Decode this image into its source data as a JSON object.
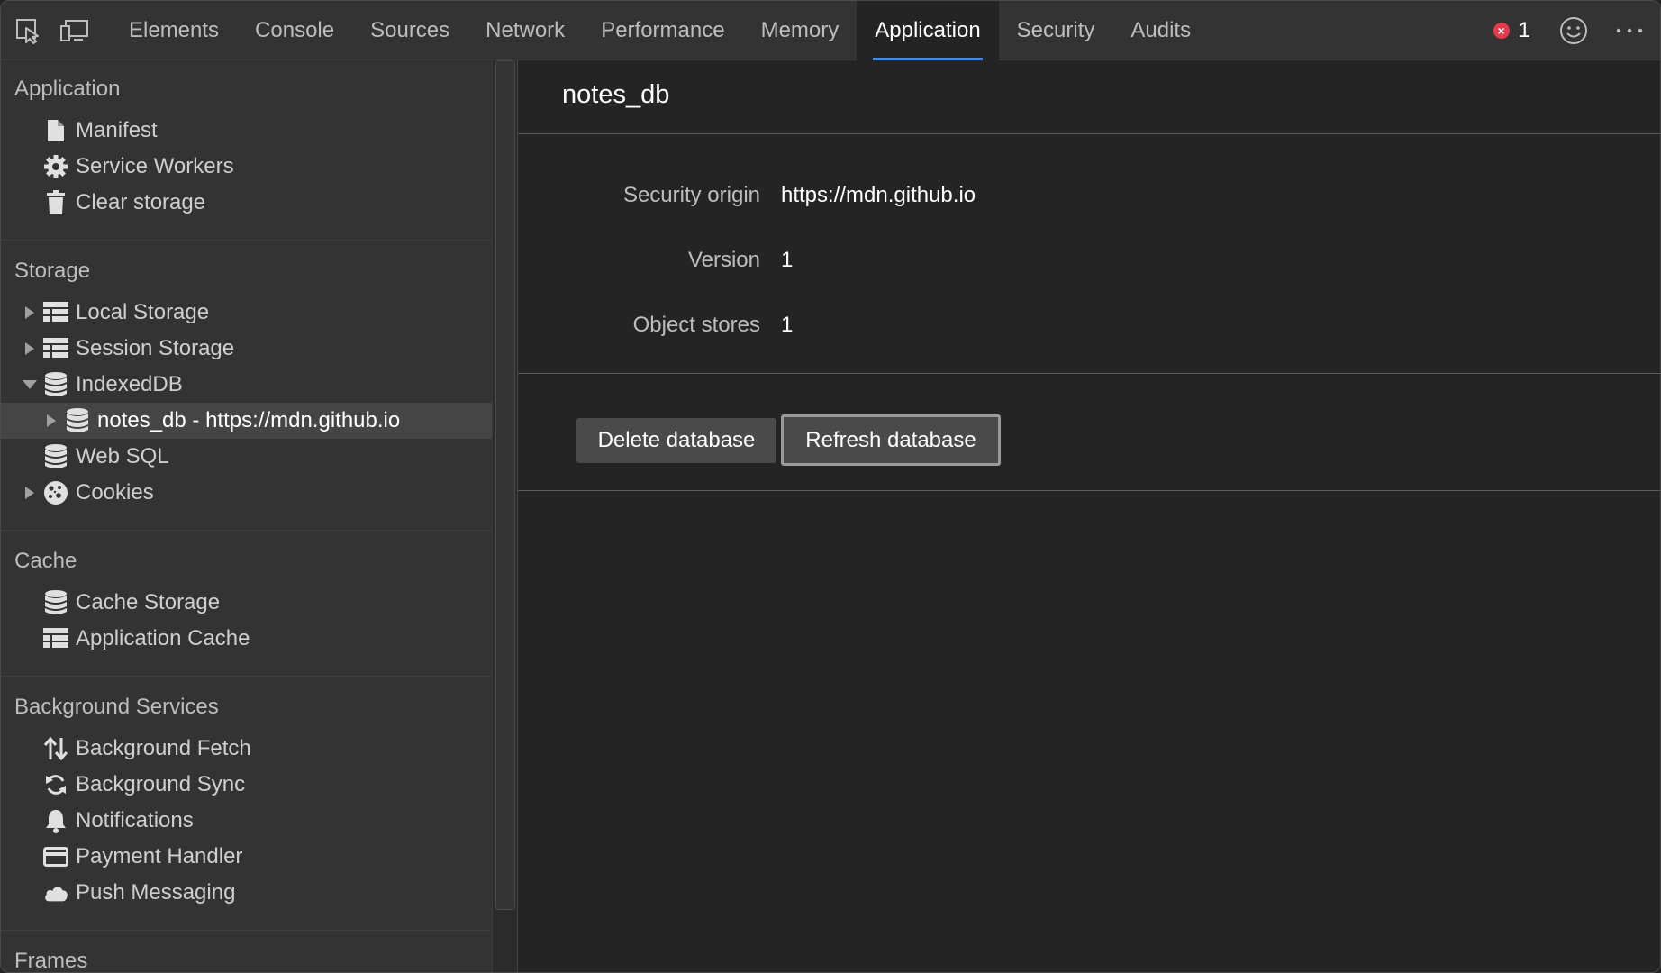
{
  "toolbar": {
    "tabs": [
      {
        "label": "Elements"
      },
      {
        "label": "Console"
      },
      {
        "label": "Sources"
      },
      {
        "label": "Network"
      },
      {
        "label": "Performance"
      },
      {
        "label": "Memory"
      },
      {
        "label": "Application"
      },
      {
        "label": "Security"
      },
      {
        "label": "Audits"
      }
    ],
    "active_tab": "Application",
    "error_count": "1",
    "error_icon": "×"
  },
  "sidebar": {
    "sections": {
      "application": {
        "title": "Application",
        "items": [
          {
            "label": "Manifest",
            "icon": "document-icon"
          },
          {
            "label": "Service Workers",
            "icon": "gear-icon"
          },
          {
            "label": "Clear storage",
            "icon": "trash-icon"
          }
        ]
      },
      "storage": {
        "title": "Storage",
        "items": [
          {
            "label": "Local Storage",
            "icon": "grid-icon"
          },
          {
            "label": "Session Storage",
            "icon": "grid-icon"
          },
          {
            "label": "IndexedDB",
            "icon": "database-icon"
          },
          {
            "label": "notes_db - https://mdn.github.io",
            "icon": "database-icon"
          },
          {
            "label": "Web SQL",
            "icon": "database-icon"
          },
          {
            "label": "Cookies",
            "icon": "cookie-icon"
          }
        ]
      },
      "cache": {
        "title": "Cache",
        "items": [
          {
            "label": "Cache Storage",
            "icon": "database-icon"
          },
          {
            "label": "Application Cache",
            "icon": "grid-icon"
          }
        ]
      },
      "background": {
        "title": "Background Services",
        "items": [
          {
            "label": "Background Fetch",
            "icon": "up-down-arrows-icon"
          },
          {
            "label": "Background Sync",
            "icon": "sync-icon"
          },
          {
            "label": "Notifications",
            "icon": "bell-icon"
          },
          {
            "label": "Payment Handler",
            "icon": "card-icon"
          },
          {
            "label": "Push Messaging",
            "icon": "cloud-icon"
          }
        ]
      },
      "frames": {
        "title": "Frames"
      }
    }
  },
  "main": {
    "title": "notes_db",
    "fields": [
      {
        "key": "Security origin",
        "value": "https://mdn.github.io"
      },
      {
        "key": "Version",
        "value": "1"
      },
      {
        "key": "Object stores",
        "value": "1"
      }
    ],
    "buttons": {
      "delete": "Delete database",
      "refresh": "Refresh database"
    }
  },
  "colors": {
    "accent": "#3d8ef0",
    "error": "#e8394a",
    "panel": "#333333",
    "background": "#242424"
  }
}
